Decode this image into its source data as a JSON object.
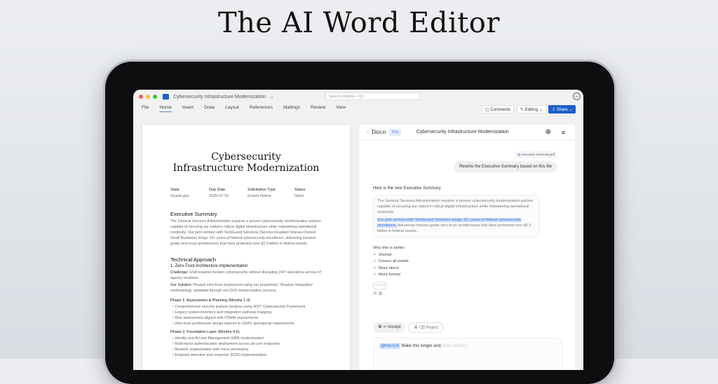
{
  "hero_title": "The AI Word Editor",
  "window": {
    "title": "Cybersecurity Infrastructure Modernization",
    "search_placeholder": "Search (Option + Q)",
    "avatar": "JD"
  },
  "ribbon": {
    "tabs": [
      "File",
      "Home",
      "Insert",
      "Draw",
      "Layout",
      "References",
      "Mailings",
      "Review",
      "View"
    ],
    "comments": "Comments",
    "editing": "Editing",
    "share": "Share"
  },
  "doc": {
    "title_line1": "Cybersecurity",
    "title_line2": "Infrastructure Modernization",
    "meta": [
      {
        "label": "State",
        "value": "Grants.gov"
      },
      {
        "label": "Due Date",
        "value": "2025-07-15"
      },
      {
        "label": "Solicitation Type",
        "value": "Grants Notice"
      },
      {
        "label": "Status",
        "value": "Open"
      }
    ],
    "exec_heading": "Executive Summary",
    "exec_text": "The General Services Administration requires a proven cybersecurity modernization partner capable of securing our nation's critical digital infrastructure while maintaining operational continuity. Our joint venture with TechGuard Solutions (Service-Disabled Veteran-Owned Small Business) brings 15+ years of federal cybersecurity excellence, delivering mission-grade zero-trust architectures that have protected over $2.3 billion in federal assets.",
    "tech_heading": "Technical Approach",
    "sub1": "1. Zero-Trust Architecture Implementation",
    "challenge_label": "Challenge:",
    "challenge_text": " GSA requires modern cybersecurity without disrupting 24/7 operations across 47 agency locations.",
    "solution_label": "Our Solution:",
    "solution_text": " Phased zero-trust deployment using our proprietary \"Shadow Integration\" methodology, validated through our DHS modernization success.",
    "phase1": "Phase 1: Assessment & Planning (Months 1-3)",
    "phase1_items": [
      "Comprehensive security posture analysis using NIST Cybersecurity Framework",
      "Legacy system inventory and integration pathway mapping",
      "Risk assessment aligned with FISMA requirements",
      "Zero-trust architecture design tailored to GSA's operational requirements"
    ],
    "phase2": "Phase 2: Foundation Layer (Months 4-6)",
    "phase2_items": [
      "Identity and Access Management (IAM) modernization",
      "Multi-factor authentication deployment across all user endpoints",
      "Network segmentation with micro-perimeters",
      "Endpoint detection and response (EDR) implementation"
    ]
  },
  "chat": {
    "brand": "Doco",
    "badge": "Pro",
    "title": "Cybersecurity Infrastructure Modernization",
    "attachment": "Executive Summary.pdf",
    "user_msg": "Rewrite the Executive Summary based on this file",
    "resp_heading": "Here is the new Executive Summary",
    "resp_text1": "The General Services Administration requires a proven cybersecurity modernization partner capable of securing our nation's critical digital infrastructure while maintaining operational continuity.",
    "resp_highlight": "Our joint venture with TechGuard Solutions brings 15+ years of federal cybersecurity excellence,",
    "resp_text2": " delivering mission-grade zero-trust architectures that have protected over $2.3 billion in federal assets.",
    "why_heading": "Why this is better:",
    "why_items": [
      "Shorter",
      "Covers all points",
      "More direct",
      "More formal"
    ],
    "citations": "1 2 3 +6",
    "accept": "⌘ ↵ Accept",
    "reject": "⌘ ⌫ Reject",
    "input_tag": "@line:5-6",
    "input_text": "Make this longer and",
    "input_placeholder": "more detailed"
  }
}
